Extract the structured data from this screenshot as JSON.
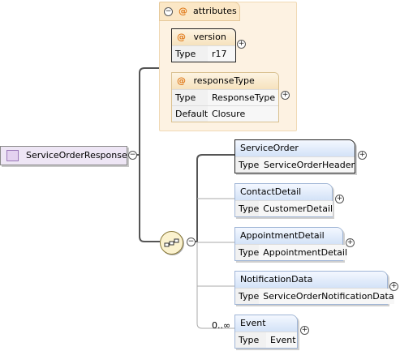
{
  "root": {
    "name": "ServiceOrderResponse"
  },
  "attributes": {
    "group_label": "attributes",
    "items": [
      {
        "name": "version",
        "rows": [
          {
            "key": "Type",
            "value": "r17"
          }
        ]
      },
      {
        "name": "responseType",
        "rows": [
          {
            "key": "Type",
            "value": "ResponseType"
          },
          {
            "key": "Default",
            "value": "Closure"
          }
        ]
      }
    ]
  },
  "elements": [
    {
      "name": "ServiceOrder",
      "type_key": "Type",
      "type": "ServiceOrderHeader"
    },
    {
      "name": "ContactDetail",
      "type_key": "Type",
      "type": "CustomerDetail"
    },
    {
      "name": "AppointmentDetail",
      "type_key": "Type",
      "type": "AppointmentDetail"
    },
    {
      "name": "NotificationData",
      "type_key": "Type",
      "type": "ServiceOrderNotificationData"
    },
    {
      "name": "Event",
      "type_key": "Type",
      "type": "Event",
      "occurrence": "0..∞"
    }
  ],
  "symbols": {
    "at": "@",
    "minus": "−",
    "plus": "+"
  },
  "colors": {
    "attr_bg": "#fdf2e2",
    "element_head": "#d3e2f7",
    "root_bg": "#eee6f5"
  }
}
